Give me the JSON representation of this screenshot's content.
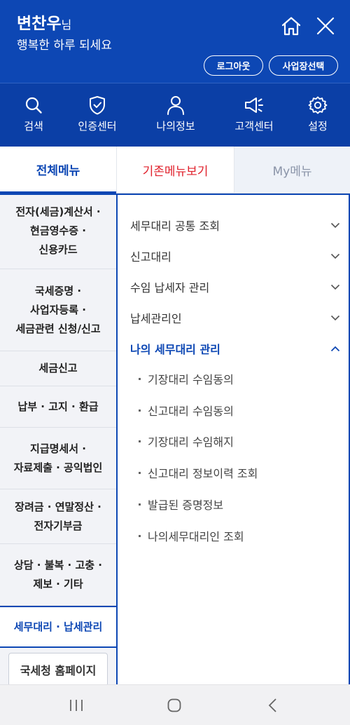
{
  "header": {
    "user_name": "변찬우",
    "user_suffix": "님",
    "greeting": "행복한 하루 되세요",
    "logout_label": "로그아웃",
    "select_business_label": "사업장선택"
  },
  "quick_nav": [
    {
      "label": "검색",
      "icon": "search-icon"
    },
    {
      "label": "인증센터",
      "icon": "shield-check-icon"
    },
    {
      "label": "나의정보",
      "icon": "person-icon"
    },
    {
      "label": "고객센터",
      "icon": "megaphone-icon"
    },
    {
      "label": "설정",
      "icon": "gear-icon"
    }
  ],
  "tabs": {
    "all": "전체메뉴",
    "legacy": "기존메뉴보기",
    "my": "My메뉴"
  },
  "categories": [
    {
      "lines": [
        "전자(세금)계산서 ·",
        "현금영수증 ·",
        "신용카드"
      ]
    },
    {
      "lines": [
        "국세증명 ·",
        "사업자등록 ·",
        "세금관련 신청/신고"
      ]
    },
    {
      "lines": [
        "세금신고"
      ]
    },
    {
      "lines": [
        "납부 · 고지 · 환급"
      ]
    },
    {
      "lines": [
        "지급명세서 ·",
        "자료제출 · 공익법인"
      ]
    },
    {
      "lines": [
        "장려금 · 연말정산 ·",
        "전자기부금"
      ]
    },
    {
      "lines": [
        "상담 · 불복 · 고충 ·",
        "제보 · 기타"
      ]
    },
    {
      "lines": [
        "세무대리 · 납세관리"
      ]
    }
  ],
  "active_category": "세무대리 · 납세관리",
  "homepage_button": "국세청 홈페이지",
  "submenu": [
    {
      "label": "세무대리 공통 조회",
      "expanded": false
    },
    {
      "label": "신고대리",
      "expanded": false
    },
    {
      "label": "수임 납세자 관리",
      "expanded": false
    },
    {
      "label": "납세관리인",
      "expanded": false
    },
    {
      "label": "나의 세무대리 관리",
      "expanded": true
    }
  ],
  "submenu_children": [
    "기장대리 수임동의",
    "신고대리 수임동의",
    "기장대리 수임해지",
    "신고대리 정보이력 조회",
    "발급된 증명정보",
    "나의세무대리인 조회"
  ],
  "colors": {
    "primary": "#0d47b4",
    "accent_red": "#e0202b"
  }
}
